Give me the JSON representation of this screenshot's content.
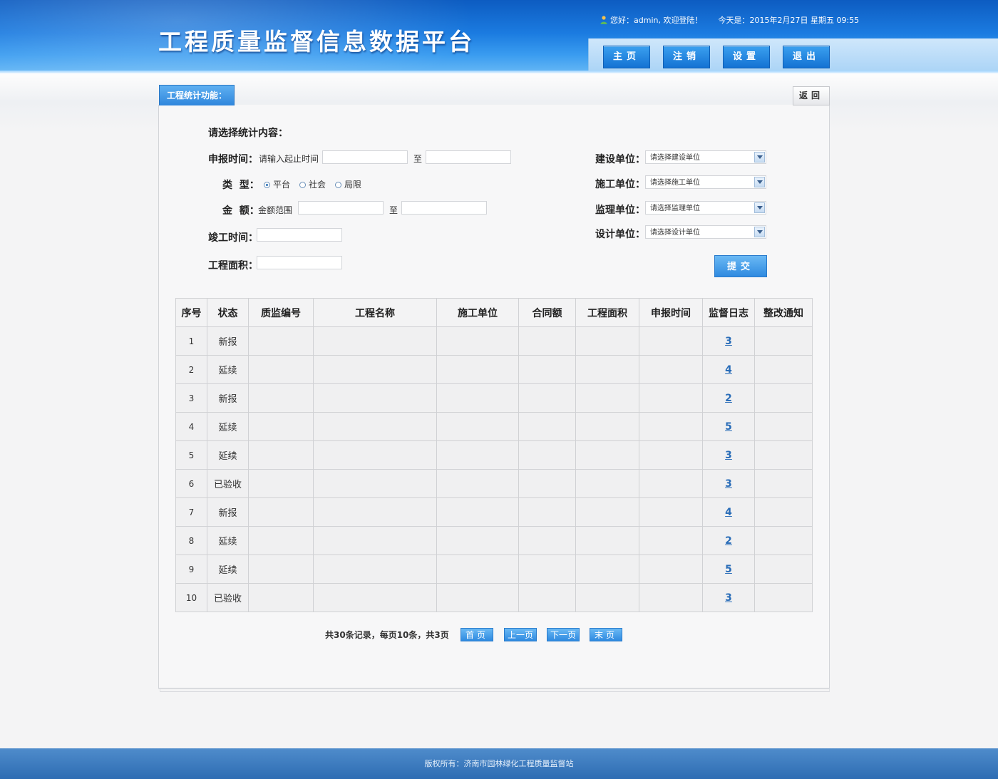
{
  "header": {
    "site_title": "工程质量监督信息数据平台",
    "greeting": "您好：admin, 欢迎登陆！",
    "date_text": "今天是：2015年2月27日  星期五  09:55",
    "nav": [
      {
        "label": "主页"
      },
      {
        "label": "注销"
      },
      {
        "label": "设置"
      },
      {
        "label": "退出"
      }
    ]
  },
  "tab_label": "工程统计功能：",
  "back_label": "返回",
  "form": {
    "section_title": "请选择统计内容：",
    "report_time_label": "申报时间：",
    "report_time_hint": "请输入起止时间",
    "to_label": "至",
    "type_label": "类  型：",
    "type_options": [
      {
        "label": "平台",
        "checked": true
      },
      {
        "label": "社会",
        "checked": false
      },
      {
        "label": "局限",
        "checked": false
      }
    ],
    "amount_label": "金  额：",
    "amount_hint": "金额范围",
    "complete_time_label": "竣工时间：",
    "area_label": "工程面积：",
    "build_unit_label": "建设单位：",
    "build_unit_placeholder": "请选择建设单位",
    "construct_unit_label": "施工单位：",
    "construct_unit_placeholder": "请选择施工单位",
    "supervise_unit_label": "监理单位：",
    "supervise_unit_placeholder": "请选择监理单位",
    "design_unit_label": "设计单位：",
    "design_unit_placeholder": "请选择设计单位",
    "submit_label": "提交"
  },
  "table": {
    "headers": [
      "序号",
      "状态",
      "质监编号",
      "工程名称",
      "施工单位",
      "合同额",
      "工程面积",
      "申报时间",
      "监督日志",
      "整改通知"
    ],
    "rows": [
      {
        "no": "1",
        "status": "新报",
        "log": "3"
      },
      {
        "no": "2",
        "status": "延续",
        "log": "4"
      },
      {
        "no": "3",
        "status": "新报",
        "log": "2"
      },
      {
        "no": "4",
        "status": "延续",
        "log": "5"
      },
      {
        "no": "5",
        "status": "延续",
        "log": "3"
      },
      {
        "no": "6",
        "status": "已验收",
        "log": "3"
      },
      {
        "no": "7",
        "status": "新报",
        "log": "4"
      },
      {
        "no": "8",
        "status": "延续",
        "log": "2"
      },
      {
        "no": "9",
        "status": "延续",
        "log": "5"
      },
      {
        "no": "10",
        "status": "已验收",
        "log": "3"
      }
    ]
  },
  "pager": {
    "info": "共30条记录，每页10条，共3页",
    "first": "首页",
    "prev": "上一页",
    "next": "下一页",
    "last": "末页"
  },
  "footer": {
    "copyright": "版权所有：济南市园林绿化工程质量监督站"
  }
}
